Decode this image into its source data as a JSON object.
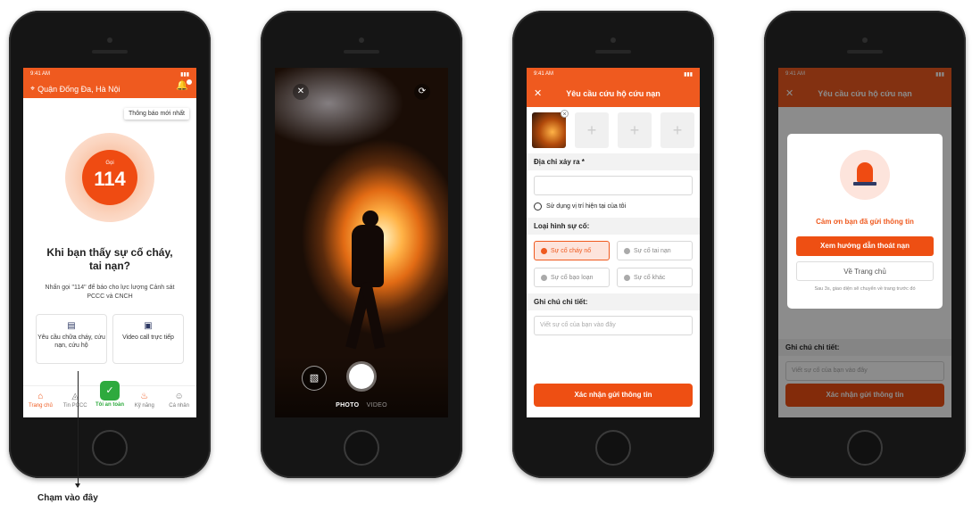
{
  "phone1": {
    "status_time": "9:41 AM",
    "location": "Quận Đống Đa, Hà Nội",
    "tooltip": "Thông báo mới nhất",
    "call_label": "Gọi",
    "call_number": "114",
    "question_line1": "Khi bạn thấy sự cố cháy,",
    "question_line2": "tai nạn?",
    "description": "Nhấn gọi \"114\" để báo cho lực lượng Cảnh sát PCCC và CNCH",
    "card_request": "Yêu cầu chữa cháy, cứu nạn, cứu hộ",
    "card_video": "Video call trực tiếp",
    "tabs": [
      "Trang chủ",
      "Tin PCCC",
      "Tôi an toàn",
      "Kỹ năng",
      "Cá nhân"
    ],
    "hint": "Chạm vào đây"
  },
  "phone2": {
    "mode_photo": "PHOTO",
    "mode_video": "VIDEO"
  },
  "phone3": {
    "status_time": "9:41 AM",
    "title": "Yêu cầu cứu hộ cứu nạn",
    "address_label": "Địa chỉ xảy ra *",
    "use_location": "Sử dụng vị trí hiện tại của tôi",
    "incident_type_label": "Loại hình sự cố:",
    "types": [
      "Sự cố cháy nổ",
      "Sự cố tai nạn",
      "Sự cố bạo loạn",
      "Sự cố khác"
    ],
    "note_label": "Ghi chú chi tiết:",
    "note_placeholder": "Viết sự cố của bạn vào đây",
    "submit": "Xác nhận gửi thông tin"
  },
  "phone4": {
    "status_time": "9:41 AM",
    "title": "Yêu cầu cứu hộ cứu nạn",
    "thanks": "Cảm ơn bạn đã gửi thông tin",
    "guide_button": "Xem hướng dẫn thoát nạn",
    "home_button": "Về Trang chủ",
    "redirect_note": "Sau 3s, giao diện sẽ chuyển về trang trước đó",
    "note_label": "Ghi chú chi tiết:",
    "note_placeholder": "Viết sự cố của bạn vào đây",
    "submit": "Xác nhận gửi thông tin"
  },
  "colors": {
    "accent": "#ef5a1f",
    "safe": "#2eaa3e"
  }
}
